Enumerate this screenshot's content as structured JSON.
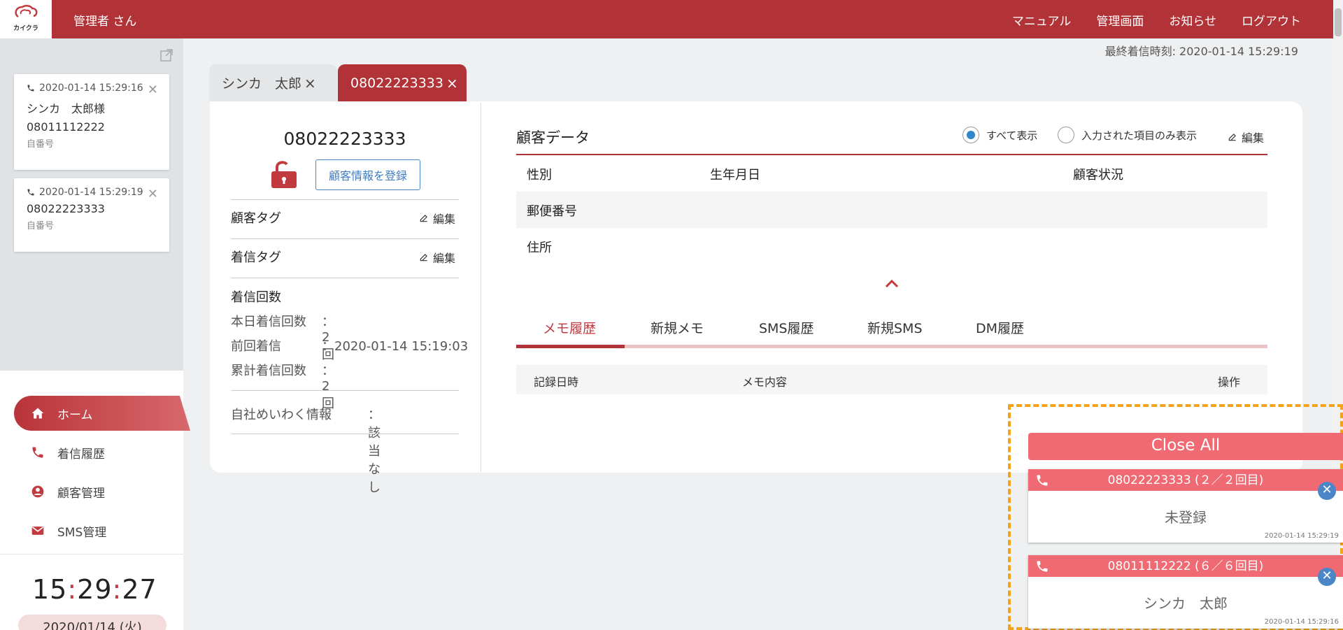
{
  "header": {
    "logo_text": "カイクラ",
    "user": "管理者 さん",
    "nav": [
      "マニュアル",
      "管理画面",
      "お知らせ",
      "ログアウト"
    ]
  },
  "last_call": "最終着信時刻: 2020-01-14 15:29:19",
  "call_cards": [
    {
      "time": "2020-01-14 15:29:16",
      "name": "シンカ　太郎様",
      "number": "08011112222",
      "kind": "自番号"
    },
    {
      "time": "2020-01-14 15:29:19",
      "number": "08022223333",
      "kind": "自番号"
    }
  ],
  "sidebar_nav": [
    {
      "label": "ホーム",
      "icon": "home-icon"
    },
    {
      "label": "着信履歴",
      "icon": "phone-icon"
    },
    {
      "label": "顧客管理",
      "icon": "user-circle-icon"
    },
    {
      "label": "SMS管理",
      "icon": "mail-icon"
    }
  ],
  "clock": {
    "h": "15",
    "m": "29",
    "s": "27",
    "date": "2020/01/14 (火)"
  },
  "tabs": [
    {
      "label": "シンカ　太郎",
      "close": "×"
    },
    {
      "label": "08022223333",
      "close": "×"
    }
  ],
  "customer": {
    "phone": "08022223333",
    "register_button": "顧客情報を登録",
    "customer_tag": "顧客タグ",
    "call_tag": "着信タグ",
    "edit": "編集",
    "call_count_title": "着信回数",
    "stats": [
      {
        "label": "本日着信回数",
        "value": "：2回"
      },
      {
        "label": "前回着信",
        "value": "：2020-01-14 15:19:03"
      },
      {
        "label": "累計着信回数",
        "value": "：2回"
      }
    ],
    "nuisance_label": "自社めいわく情報",
    "nuisance_value": "：該当なし"
  },
  "customer_data": {
    "title": "顧客データ",
    "radio_all": "すべて表示",
    "radio_filled": "入力された項目のみ表示",
    "edit": "編集",
    "fields": {
      "gender": "性別",
      "birthday": "生年月日",
      "status": "顧客状況",
      "zip": "郵便番号",
      "address": "住所"
    }
  },
  "sub_tabs": [
    "メモ履歴",
    "新規メモ",
    "SMS履歴",
    "新規SMS",
    "DM履歴"
  ],
  "memo_table": {
    "col_date": "記録日時",
    "col_content": "メモ内容",
    "col_action": "操作"
  },
  "notifications": {
    "close_all": "Close All",
    "items": [
      {
        "header": "08022223333 (２／２回目)",
        "name": "未登録",
        "time": "2020-01-14 15:29:19"
      },
      {
        "header": "08011112222 (６／６回目)",
        "name": "シンカ　太郎",
        "time": "2020-01-14 15:29:16"
      }
    ]
  },
  "colors": {
    "brand": "#b13337",
    "notif": "#ef6a73",
    "highlight": "#f2a31b"
  }
}
